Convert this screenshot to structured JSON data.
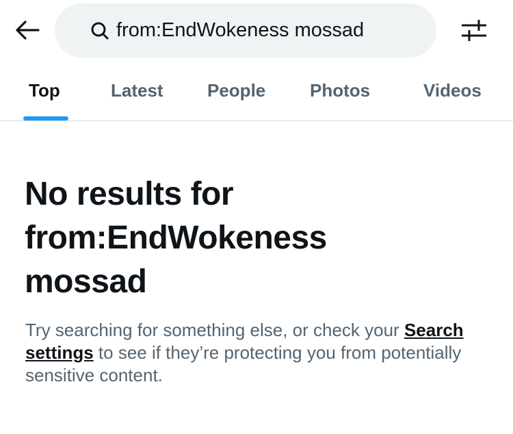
{
  "header": {
    "back_icon": "arrow-left-icon",
    "search": {
      "icon": "search-icon",
      "query": "from:EndWokeness mossad"
    },
    "filter_icon": "sliders-icon"
  },
  "tabs": [
    {
      "label": "Top",
      "active": true
    },
    {
      "label": "Latest",
      "active": false
    },
    {
      "label": "People",
      "active": false
    },
    {
      "label": "Photos",
      "active": false
    },
    {
      "label": "Videos",
      "active": false
    }
  ],
  "empty_state": {
    "title_lines": [
      "No results for",
      "from:EndWokeness",
      "mossad"
    ],
    "desc_prefix": "Try searching for something else, or check your ",
    "link_label": "Search settings",
    "desc_suffix": " to see if they’re protecting you from potentially sensitive content."
  },
  "colors": {
    "text_primary": "#0f1419",
    "text_secondary": "#536471",
    "accent": "#1d9bf0",
    "search_bg": "#eff3f4",
    "divider": "#cfd9de"
  }
}
